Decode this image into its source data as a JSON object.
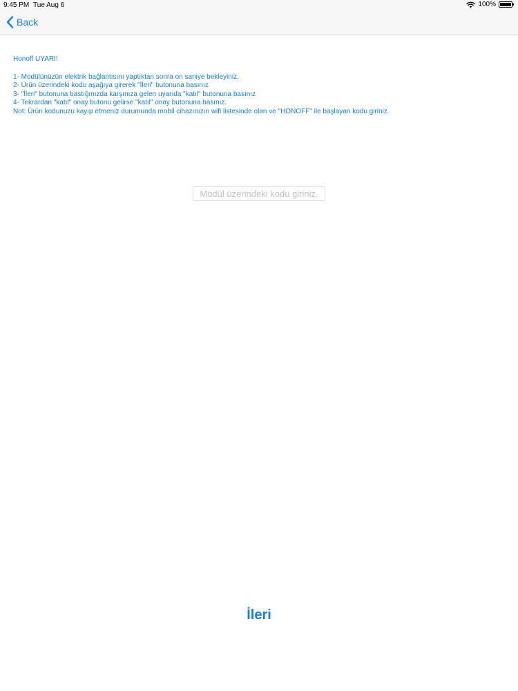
{
  "status_bar": {
    "time": "9:45 PM",
    "date": "Tue Aug 6",
    "battery": "100%"
  },
  "nav": {
    "back_label": "Back"
  },
  "warning": {
    "title": "Honoff UYARI!",
    "lines": [
      "1- Modülünüzün elektrik bağlantısını yaptıktan sonra on saniye bekleyiniz.",
      "2- Ürün üzerindeki kodu aşağıya girerek \"İleri\" butonuna basınız",
      "3- \"İleri\" butonuna bastığınızda karşınıza gelen uyarıda \"katıl\" butonuna basınız",
      "4- Tekrardan \"katıl\" onay butonu gelirse \"katıl\" onay butonuna basınız.",
      "Not: Ürün kodunuzu kayıp etmeniz durumunda mobil cihazınızın wifi listesinde olan ve \"HONOFF\" ile başlayan kodu giriniz."
    ]
  },
  "code_input": {
    "value": "",
    "placeholder": "Modül üzerindeki kodu giriniz."
  },
  "next_button": {
    "label": "İleri"
  },
  "colors": {
    "accent": "#1a7fe0",
    "nav_background": "#f7f7f8"
  },
  "icons": {
    "status_wifi": "wifi-icon",
    "status_battery": "battery-icon",
    "nav_back": "chevron-left-icon"
  }
}
